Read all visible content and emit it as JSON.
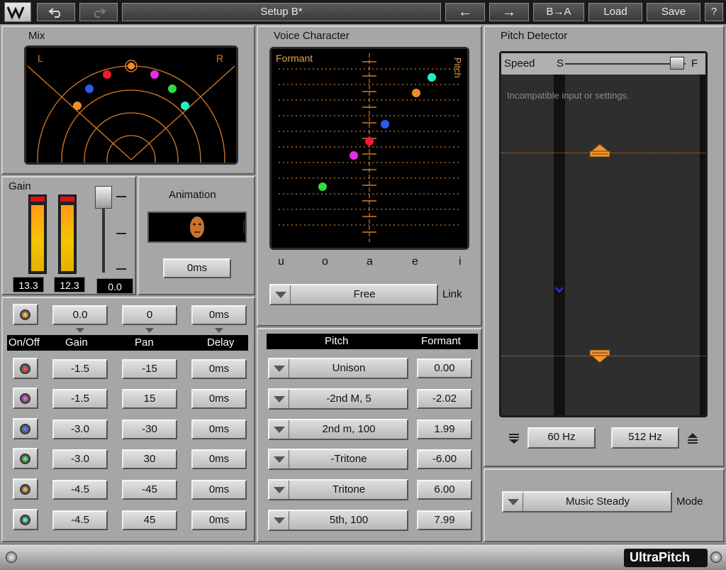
{
  "toolbar": {
    "logo": "W",
    "undo_icon": "undo-icon",
    "redo_icon": "redo-icon",
    "preset_name": "Setup B*",
    "prev_label": "←",
    "next_label": "→",
    "copy_label": "B→A",
    "load_label": "Load",
    "save_label": "Save",
    "help_label": "?"
  },
  "mix": {
    "title": "Mix",
    "left_label": "L",
    "right_label": "R",
    "dots": [
      {
        "color": "#f08c28"
      },
      {
        "color": "#ee1c2e"
      },
      {
        "color": "#2d5be8"
      },
      {
        "color": "#e52ee5"
      },
      {
        "color": "#2edc3c"
      },
      {
        "color": "#1ef0c8"
      }
    ]
  },
  "gain": {
    "title": "Gain",
    "meter_left": "13.3",
    "meter_right": "12.3",
    "fader_value": "0.0"
  },
  "animation": {
    "title": "Animation",
    "value": "0ms"
  },
  "voice_character": {
    "title": "Voice Character",
    "formant_label": "Formant",
    "pitch_label": "Pitch",
    "vowels": [
      "u",
      "o",
      "a",
      "e",
      "i"
    ],
    "link_mode": "Free",
    "link_label": "Link"
  },
  "voices": {
    "master": {
      "gain": "0.0",
      "pan": "0",
      "delay": "0ms"
    },
    "headers": {
      "onoff": "On/Off",
      "gain": "Gain",
      "pan": "Pan",
      "delay": "Delay",
      "pitch": "Pitch",
      "formant": "Formant"
    },
    "rows": [
      {
        "led": "#d83a3a",
        "gain": "-1.5",
        "pan": "-15",
        "delay": "0ms",
        "pitch": "Unison",
        "formant": "0.00"
      },
      {
        "led": "#d23ad2",
        "gain": "-1.5",
        "pan": "15",
        "delay": "0ms",
        "pitch": "-2nd M, 5",
        "formant": "-2.02"
      },
      {
        "led": "#3a5ad8",
        "gain": "-3.0",
        "pan": "-30",
        "delay": "0ms",
        "pitch": "2nd m, 100",
        "formant": "1.99"
      },
      {
        "led": "#2ec83a",
        "gain": "-3.0",
        "pan": "30",
        "delay": "0ms",
        "pitch": "-Tritone",
        "formant": "-6.00"
      },
      {
        "led": "#f0962a",
        "gain": "-4.5",
        "pan": "-45",
        "delay": "0ms",
        "pitch": "Tritone",
        "formant": "6.00"
      },
      {
        "led": "#1ed2aa",
        "gain": "-4.5",
        "pan": "45",
        "delay": "0ms",
        "pitch": "5th, 100",
        "formant": "7.99"
      }
    ]
  },
  "pitch_detector": {
    "title": "Pitch Detector",
    "speed_label": "Speed",
    "speed_slow": "S",
    "speed_fast": "F",
    "message": "Incompatible input or settings.",
    "low_freq": "60 Hz",
    "high_freq": "512 Hz",
    "mode_value": "Music Steady",
    "mode_label": "Mode"
  },
  "footer": {
    "brand": "UltraPitch"
  }
}
